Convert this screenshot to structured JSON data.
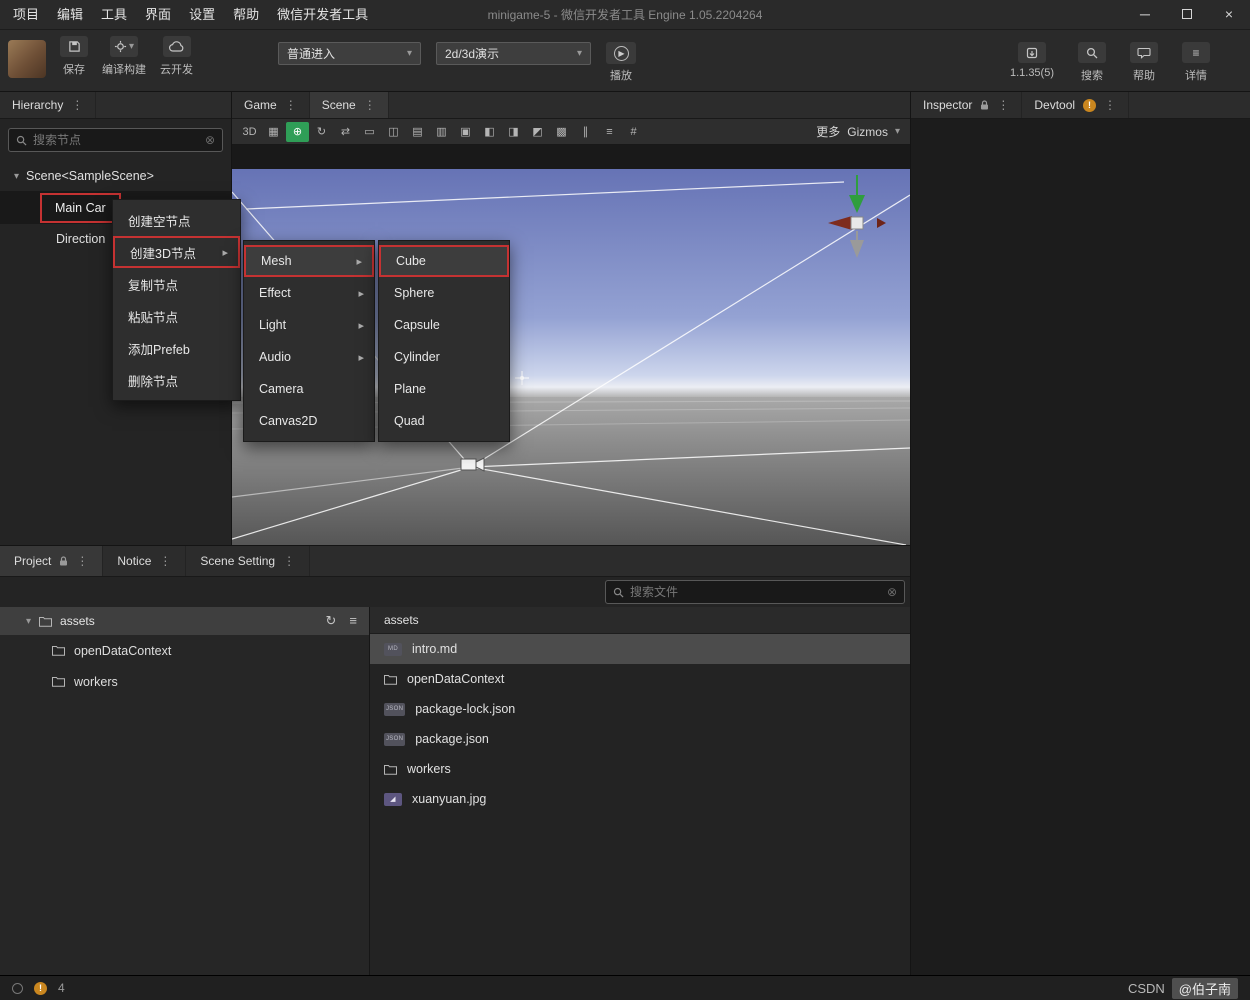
{
  "colors": {
    "annotation_red": "#c53232",
    "tool_active_green": "#2f9e57",
    "warning_orange": "#c9861f"
  },
  "icons": {
    "minimize": "─",
    "close": "×",
    "dots": "⋮",
    "caret_down": "▾",
    "caret_right": "▸",
    "clear": "⊗",
    "refresh": "↻",
    "list": "≡",
    "play": "▶"
  },
  "titlebar": {
    "menus": [
      "项目",
      "编辑",
      "工具",
      "界面",
      "设置",
      "帮助",
      "微信开发者工具"
    ],
    "title": "minigame-5 - 微信开发者工具 Engine 1.05.2204264"
  },
  "toolbar": {
    "save": "保存",
    "build": "编译构建",
    "cloud": "云开发",
    "mode_value": "普通进入",
    "demo_value": "2d/3d演示",
    "play": "播放",
    "version": "1.1.35(5)",
    "search": "搜索",
    "help": "帮助",
    "detail": "详情"
  },
  "hierarchy": {
    "title": "Hierarchy",
    "search_placeholder": "搜索节点",
    "scene_node": "Scene<SampleScene>",
    "selected_node": "Main Car",
    "child_node": "Direction"
  },
  "context_menu": {
    "items": [
      "创建空节点",
      "创建3D节点",
      "复制节点",
      "粘贴节点",
      "添加Prefeb",
      "删除节点"
    ]
  },
  "node3d_menu": {
    "items": [
      "Mesh",
      "Effect",
      "Light",
      "Audio",
      "Camera",
      "Canvas2D"
    ]
  },
  "mesh_menu": {
    "items": [
      "Cube",
      "Sphere",
      "Capsule",
      "Cylinder",
      "Plane",
      "Quad"
    ]
  },
  "viewport": {
    "tab_game": "Game",
    "tab_scene": "Scene",
    "more": "更多",
    "gizmos": "Gizmos",
    "tools": [
      "3D",
      "▦",
      "⊕",
      "↻",
      "⇄",
      "▭",
      "◫",
      "▤",
      "▥",
      "▣",
      "◧",
      "◨",
      "◩",
      "▩",
      "∥",
      "≡",
      "#"
    ]
  },
  "inspector": {
    "tab_inspector": "Inspector",
    "tab_devtool": "Devtool"
  },
  "project": {
    "tab_project": "Project",
    "tab_notice": "Notice",
    "tab_scene_setting": "Scene Setting",
    "search_placeholder": "搜索文件",
    "tree_root": "assets",
    "tree_children": [
      "openDataContext",
      "workers"
    ],
    "list_header": "assets",
    "files": [
      {
        "name": "intro.md",
        "type": "md",
        "badge_label": "MD"
      },
      {
        "name": "openDataContext",
        "type": "folder"
      },
      {
        "name": "package-lock.json",
        "type": "json",
        "badge_label": "JSON"
      },
      {
        "name": "package.json",
        "type": "json",
        "badge_label": "JSON"
      },
      {
        "name": "workers",
        "type": "folder"
      },
      {
        "name": "xuanyuan.jpg",
        "type": "image"
      }
    ]
  },
  "statusbar": {
    "warning_count": "4",
    "watermark_left": "CSDN",
    "watermark_right": "@伯子南"
  }
}
